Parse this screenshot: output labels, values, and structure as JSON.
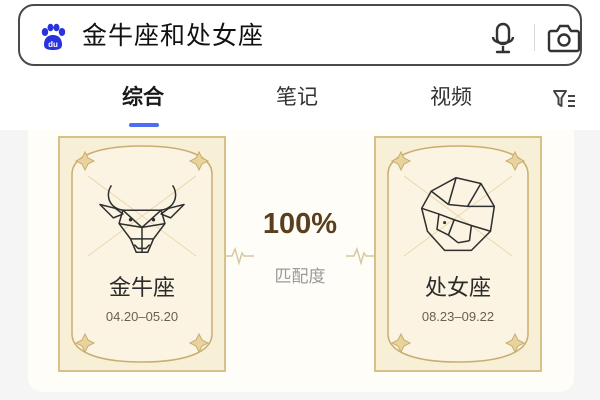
{
  "search": {
    "query": "金牛座和处女座",
    "icons": [
      "baidu-paw-icon",
      "microphone-icon",
      "camera-icon"
    ]
  },
  "tabs": [
    {
      "label": "综合",
      "active": true
    },
    {
      "label": "笔记",
      "active": false
    },
    {
      "label": "视频",
      "active": false
    }
  ],
  "filter_icon": "filter-icon",
  "match": {
    "left_sign": {
      "name": "金牛座",
      "dates": "04.20–05.20",
      "icon": "taurus-bull-icon"
    },
    "right_sign": {
      "name": "处女座",
      "dates": "08.23–09.22",
      "icon": "virgo-maiden-icon"
    },
    "percent": "100%",
    "label": "匹配度"
  },
  "colors": {
    "accent": "#4e6ef2",
    "card_gold": "#d8c08a",
    "card_fill": "#f8efd7",
    "percent_text": "#5a3f1f"
  }
}
